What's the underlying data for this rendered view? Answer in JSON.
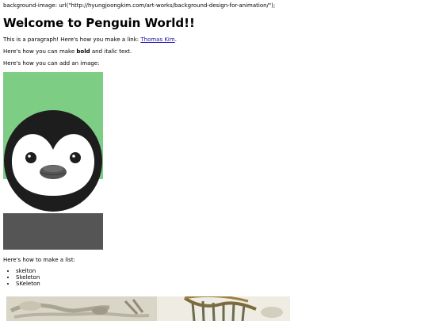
{
  "code_line": "background-image: url(\"http://hyungjoongkim.com/art-works/background-design-for-animation/\");",
  "title": "Welcome to Penguin World!!",
  "para1": {
    "before": "This is a paragraph! Here's how you make a link: ",
    "link": "Thomas Kim",
    "after": "."
  },
  "para2": {
    "before": "Here's how you can make ",
    "bold": "bold",
    "middle": " and ",
    "italic": "italic",
    "after": " text."
  },
  "para3": "Here's how you can add an image:",
  "penguin_image": {
    "icon": "penguin-illustration",
    "bg_color": "#7dcd85"
  },
  "para4": "Here's how to make a list:",
  "list_items": [
    "skelton",
    "Skeleton",
    "SKeleton"
  ],
  "skeleton_image": {
    "icon": "skeleton-photo"
  }
}
